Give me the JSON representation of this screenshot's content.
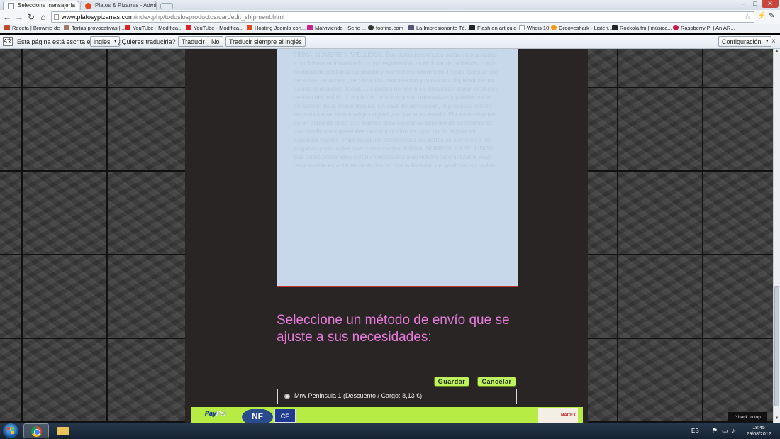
{
  "browser": {
    "tabs": [
      {
        "title": "Seleccione mensajería",
        "active": true
      },
      {
        "title": "Platos & Pizarras - Admin",
        "active": false
      }
    ],
    "url_domain": "www.platosypizarras.com",
    "url_path": "/index.php/todoslosproductos/cart/edit_shipment.html",
    "close_glyph": "×",
    "window_min": "–",
    "window_max": "□",
    "window_close": "✕"
  },
  "bookmarks": [
    {
      "label": "Receta | Brownie de",
      "icon": "page-icon",
      "color": "#c04b2c"
    },
    {
      "label": "Tartas provocativas |...",
      "icon": "page-icon",
      "color": "#9e7b6b"
    },
    {
      "label": "YouTube - Modifica...",
      "icon": "youtube-icon",
      "color": "#d22"
    },
    {
      "label": "YouTube - Modifica...",
      "icon": "youtube-icon",
      "color": "#d22"
    },
    {
      "label": "Hosting Joomla con...",
      "icon": "joomla-icon",
      "color": "#e24a22"
    },
    {
      "label": "Malviviendo - Serie ...",
      "icon": "m-icon",
      "color": "#c7238a"
    },
    {
      "label": "foofind.com",
      "icon": "foofind-icon",
      "color": "#333"
    },
    {
      "label": "La Impresionante Té...",
      "icon": "page-icon",
      "color": "#557"
    },
    {
      "label": "Flash en artículo",
      "icon": "flash-icon",
      "color": "#222"
    },
    {
      "label": "Whois 10",
      "icon": "page-icon",
      "color": "#bbb"
    },
    {
      "label": "Grooveshark - Listen...",
      "icon": "grooveshark-icon",
      "color": "#f39c12"
    },
    {
      "label": "Rockola.fm | música...",
      "icon": "rockola-icon",
      "color": "#222"
    },
    {
      "label": "Raspberry Pi | An AR...",
      "icon": "raspberry-icon",
      "color": "#c51a4a"
    }
  ],
  "translate_bar": {
    "prefix": "Esta página está escrita en",
    "language": "inglés",
    "question": "¿Quieres traducirla?",
    "translate": "Traducir",
    "no": "No",
    "always": "Traducir siempre el inglés",
    "settings": "Configuración",
    "icon_text": "A文"
  },
  "page": {
    "terms_text": "FIRMA, NOMBRE Y APELLIDOS. Sus datos personales serán incorporados a un fichero automatizado, cuyo responsable es el titular de la tienda, con la finalidad de gestionar su pedido y mantenerle informado. Puede ejercitar sus derechos de acceso, rectificación, cancelación y oposición dirigiéndose por escrito al domicilio social. Los gastos de envío se calcularán según el peso y destino del pedido. Los plazos de entrega son orientativos y pueden variar en función de la disponibilidad. En caso de devolución, el producto deberá ser remitido en su embalaje original y en perfecto estado. El cliente dispone de un plazo de siete días hábiles para ejercer su derecho de desistimiento. Las condiciones generales de contratación se rigen por la legislación española vigente. Para cualquier controversia las partes se someten a los juzgados y tribunales que correspondan. FIRMA, NOMBRE Y APELLIDOS. Sus datos personales serán incorporados a un fichero automatizado, cuyo responsable es el titular de la tienda, con la finalidad de gestionar su pedido.",
    "heading": "Seleccione un método de envío que se ajuste a sus necesidades:",
    "save_label": "Guardar",
    "cancel_label": "Cancelar",
    "shipping_option": "Mrw Peninsula 1  (Descuento / Cargo: 8,13 €)",
    "footer": {
      "paypal_pay": "Pay",
      "paypal_pal": "Pal",
      "nf": "NF",
      "ce": "CE",
      "nacex": "NACEX"
    },
    "back_to_top": "^ back to top"
  },
  "taskbar": {
    "lang": "ES",
    "time": "18:45",
    "date": "29/08/2012"
  },
  "colors": {
    "heading": "#e47bd9",
    "button": "#bff25d",
    "footer": "#b6ec43",
    "terms_bg": "#c6d8ea"
  }
}
